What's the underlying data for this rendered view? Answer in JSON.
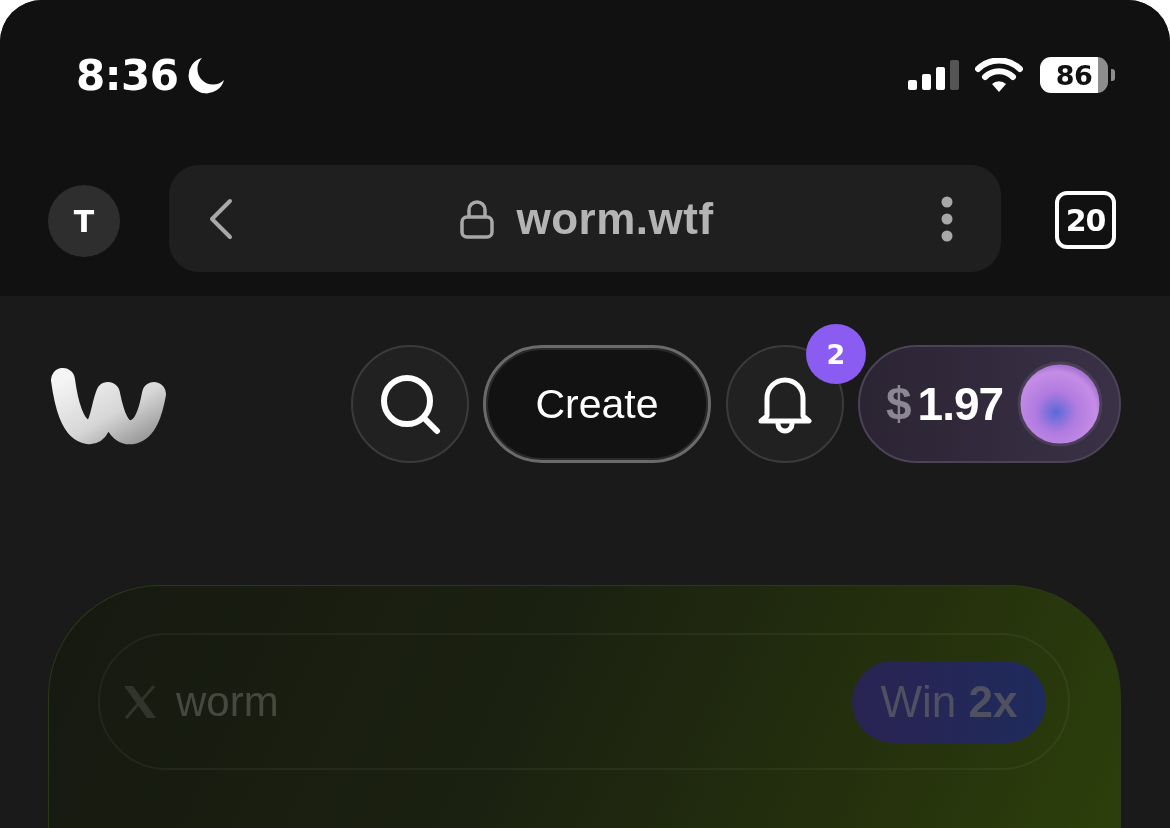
{
  "status_bar": {
    "time": "8:36",
    "battery": "86"
  },
  "browser_bar": {
    "profile_initial": "T",
    "url": "worm.wtf",
    "tab_count": "20"
  },
  "header": {
    "create_button": "Create",
    "notification_count": "2",
    "balance": {
      "currency": "$",
      "amount": "1.97"
    }
  },
  "card": {
    "handle": "worm",
    "reward": "Win **2x**"
  }
}
